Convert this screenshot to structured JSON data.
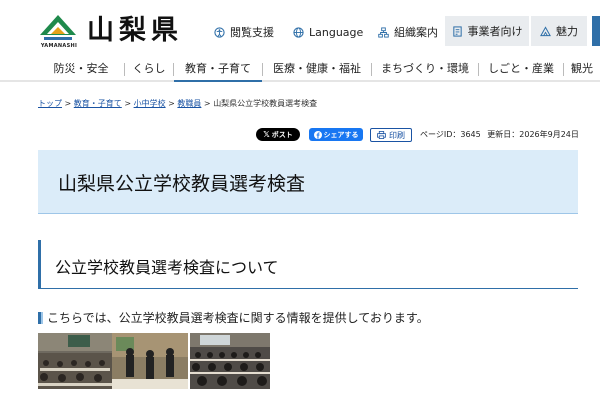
{
  "header": {
    "logo_sub": "YAMANASHI",
    "site_name": "山梨県",
    "links": [
      {
        "label": "閲覧支援",
        "icon": "accessibility-icon"
      },
      {
        "label": "Language",
        "icon": "globe-icon"
      },
      {
        "label": "組織案内",
        "icon": "organization-icon"
      }
    ],
    "boxes": [
      {
        "label": "事業者向け",
        "icon": "business-icon"
      },
      {
        "label": "魅力",
        "icon": "attraction-icon"
      }
    ]
  },
  "gnav": {
    "items": [
      "防災・安全",
      "くらし",
      "教育・子育て",
      "医療・健康・福祉",
      "まちづくり・環境",
      "しごと・産業",
      "観光"
    ],
    "active_index": 2
  },
  "breadcrumb": {
    "links": [
      "トップ",
      "教育・子育て",
      "小中学校",
      "教職員"
    ],
    "separator": " > ",
    "current": "山梨県公立学校教員選考検査"
  },
  "utility": {
    "x_post": "ポスト",
    "fb_share": "シェアする",
    "print": "印刷",
    "page_id": "ページID：3645",
    "updated": "更新日：2026年9月24日"
  },
  "main": {
    "title": "山梨県公立学校教員選考検査",
    "section_heading": "公立学校教員選考検査について",
    "paragraph": "こちらでは、公立学校教員選考検査に関する情報を提供しております。"
  },
  "colors": {
    "accent": "#2f6fa8",
    "title_bg": "#dbecf9",
    "link": "#1a53a3",
    "x_button": "#000000",
    "facebook": "#1877f2"
  }
}
